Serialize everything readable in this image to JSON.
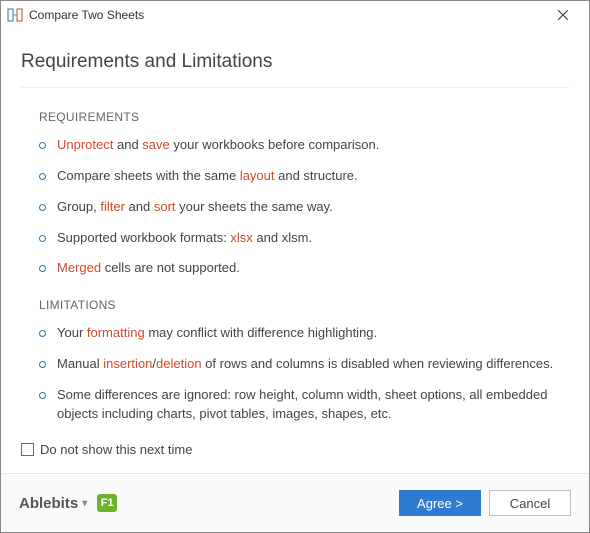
{
  "window": {
    "title": "Compare Two Sheets"
  },
  "heading": "Requirements and Limitations",
  "sections": {
    "requirements": {
      "title": "REQUIREMENTS",
      "items": [
        [
          {
            "t": "Unprotect",
            "hl": true
          },
          {
            "t": " and "
          },
          {
            "t": "save",
            "hl": true
          },
          {
            "t": " your workbooks before comparison."
          }
        ],
        [
          {
            "t": "Compare sheets with the same "
          },
          {
            "t": "layout",
            "hl": true
          },
          {
            "t": " and structure."
          }
        ],
        [
          {
            "t": "Group, "
          },
          {
            "t": "filter",
            "hl": true
          },
          {
            "t": " and "
          },
          {
            "t": "sort",
            "hl": true
          },
          {
            "t": " your sheets the same way."
          }
        ],
        [
          {
            "t": "Supported workbook formats: "
          },
          {
            "t": "xlsx",
            "hl": true
          },
          {
            "t": " and xlsm."
          }
        ],
        [
          {
            "t": "Merged",
            "hl": true
          },
          {
            "t": " cells are not supported."
          }
        ]
      ]
    },
    "limitations": {
      "title": "LIMITATIONS",
      "items": [
        [
          {
            "t": "Your "
          },
          {
            "t": "formatting",
            "hl": true
          },
          {
            "t": " may conflict with difference highlighting."
          }
        ],
        [
          {
            "t": "Manual "
          },
          {
            "t": "insertion",
            "hl": true
          },
          {
            "t": "/"
          },
          {
            "t": "deletion",
            "hl": true
          },
          {
            "t": " of rows and columns is disabled when reviewing differences."
          }
        ],
        [
          {
            "t": "Some differences are ignored: row height, column width, sheet options, all embedded objects including charts, pivot tables, images, shapes, etc."
          }
        ]
      ]
    }
  },
  "checkbox": {
    "label": "Do not show this next time",
    "checked": false
  },
  "footer": {
    "brand": "Ablebits",
    "help": "F1",
    "primary": "Agree >",
    "secondary": "Cancel"
  }
}
